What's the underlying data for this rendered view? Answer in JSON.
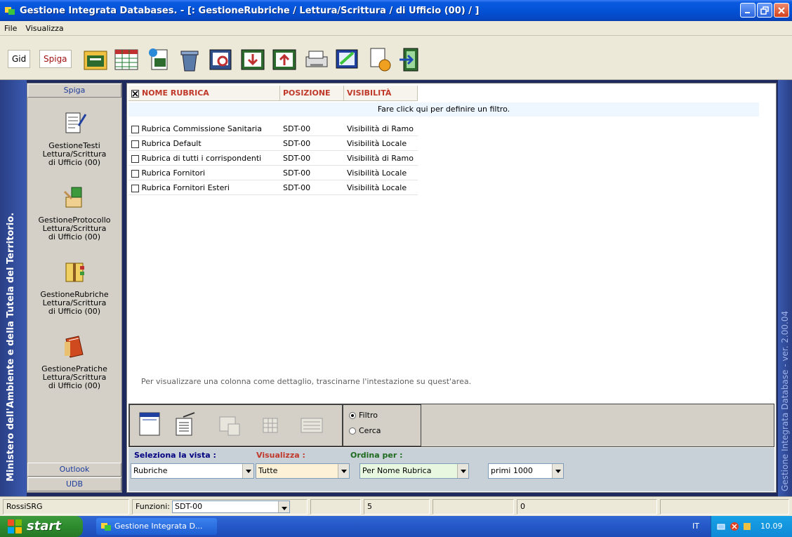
{
  "window": {
    "title": "Gestione Integrata Databases. - [: GestioneRubriche / Lettura/Scrittura / di Ufficio (00) / ]"
  },
  "menu": [
    "File",
    "Visualizza"
  ],
  "toolbar": {
    "tab_gid": "Gid",
    "tab_spiga": "Spiga"
  },
  "sidebar": {
    "header": "Spiga",
    "items": [
      {
        "l1": "GestioneTesti",
        "l2": "Lettura/Scrittura",
        "l3": "di Ufficio (00)",
        "icon": "document-pen-icon"
      },
      {
        "l1": "GestioneProtocollo",
        "l2": "Lettura/Scrittura",
        "l3": "di Ufficio (00)",
        "icon": "stamp-icon"
      },
      {
        "l1": "GestioneRubriche",
        "l2": "Lettura/Scrittura",
        "l3": "di Ufficio (00)",
        "icon": "address-book-icon"
      },
      {
        "l1": "GestionePratiche",
        "l2": "Lettura/Scrittura",
        "l3": "di Ufficio (00)",
        "icon": "folder-book-icon"
      }
    ],
    "footer_outlook": "Outlook",
    "footer_udb": "UDB"
  },
  "left_banner": "Ministero dell'Ambiente e della Tutela del Territorio.",
  "right_banner": "Gestione Integrata Database - ver. 2.00.04",
  "grid": {
    "columns": [
      "NOME RUBRICA",
      "POSIZIONE",
      "VISIBILITÀ"
    ],
    "filter_hint": "Fare click qui per definire un filtro.",
    "rows": [
      [
        "Rubrica Commissione Sanitaria",
        "SDT-00",
        "Visibilità di Ramo"
      ],
      [
        "Rubrica Default",
        "SDT-00",
        "Visibilità Locale"
      ],
      [
        "Rubrica di tutti i  corrispondenti",
        "SDT-00",
        "Visibilità di Ramo"
      ],
      [
        "Rubrica Fornitori",
        "SDT-00",
        "Visibilità Locale"
      ],
      [
        "Rubrica Fornitori Esteri",
        "SDT-00",
        "Visibilità Locale"
      ]
    ],
    "group_hint": "Per visualizzare una colonna come dettaglio, trascinarne l'intestazione su quest'area."
  },
  "radios": {
    "filtro": "Filtro",
    "cerca": "Cerca"
  },
  "viewbar": {
    "label_vista": "Seleziona la vista :",
    "label_visualizza": "Visualizza :",
    "label_ordina": "Ordina per :",
    "vista_value": "Rubriche",
    "visualizza_value": "Tutte",
    "ordina_value": "Per Nome Rubrica",
    "limit_value": "primi 1000"
  },
  "statusbar": {
    "user": "RossiSRG",
    "funzioni_label": "Funzioni:",
    "funzioni_value": "SDT-00",
    "count1": "5",
    "count2": "0"
  },
  "taskbar": {
    "start": "start",
    "task": "Gestione Integrata D...",
    "lang": "IT",
    "time": "10.09"
  },
  "colors": {
    "titlebar": "#0352d6",
    "header_text": "#c0392b",
    "banner": "#2a3f85",
    "taskbar": "#2457c7",
    "start": "#2e8b2e"
  }
}
